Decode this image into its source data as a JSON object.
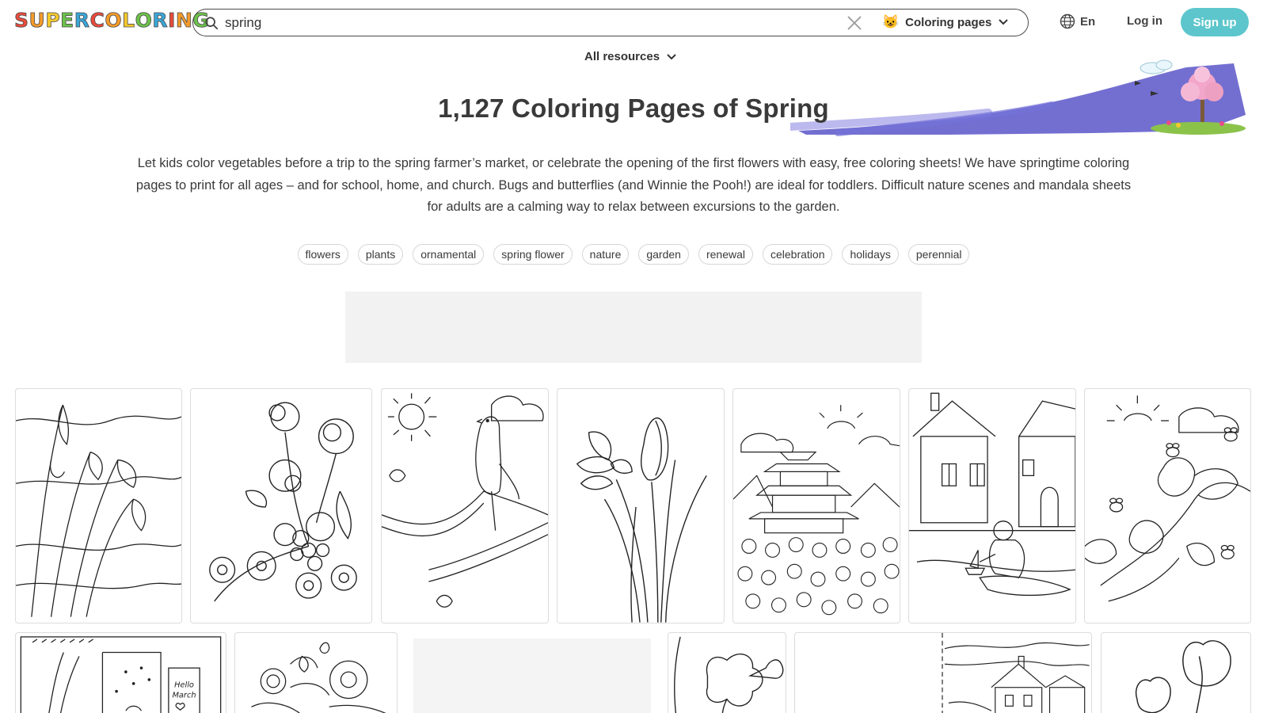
{
  "header": {
    "logo_letters": [
      "S",
      "U",
      "P",
      "E",
      "R",
      "C",
      "O",
      "L",
      "O",
      "R",
      "I",
      "N",
      "G"
    ],
    "logo_colors": [
      "#e94b3c",
      "#f49b2a",
      "#f5c92e",
      "#6cc24a",
      "#3aa6d8",
      "#e94b3c",
      "#f49b2a",
      "#f5c92e",
      "#6cc24a",
      "#3aa6d8",
      "#e94b3c",
      "#f49b2a",
      "#6cc24a"
    ],
    "search": {
      "value": "spring"
    },
    "category": {
      "emoji": "😺",
      "label": "Coloring pages"
    },
    "lang": "En",
    "login": "Log in",
    "signup": "Sign up",
    "accent_color": "#5cc6cc"
  },
  "subheader": {
    "all_resources": "All resources"
  },
  "page": {
    "title": "1,127 Coloring Pages of Spring",
    "description": "Let kids color vegetables before a trip to the spring farmer’s market, or celebrate the opening of the first flowers with easy, free coloring sheets! We have springtime coloring pages to print for all ages – and for school, home, and church. Bugs and butterflies (and Winnie the Pooh!) are ideal for toddlers. Difficult nature scenes and mandala sheets for adults are a calming way to relax between excursions to the garden.",
    "tags": [
      "flowers",
      "plants",
      "ornamental",
      "spring flower",
      "nature",
      "garden",
      "renewal",
      "celebration",
      "holidays",
      "perennial"
    ]
  },
  "grid": {
    "row1": [
      "snowdrops",
      "flower-bouquet",
      "bird-on-branch",
      "crocus",
      "pagoda",
      "boy-with-boat",
      "magnolia-bees"
    ],
    "row2": [
      "hello-march-window",
      "roses",
      "loading",
      "daffodil",
      "village-house",
      "tulips"
    ],
    "note_text": [
      "Hello",
      "March"
    ]
  }
}
